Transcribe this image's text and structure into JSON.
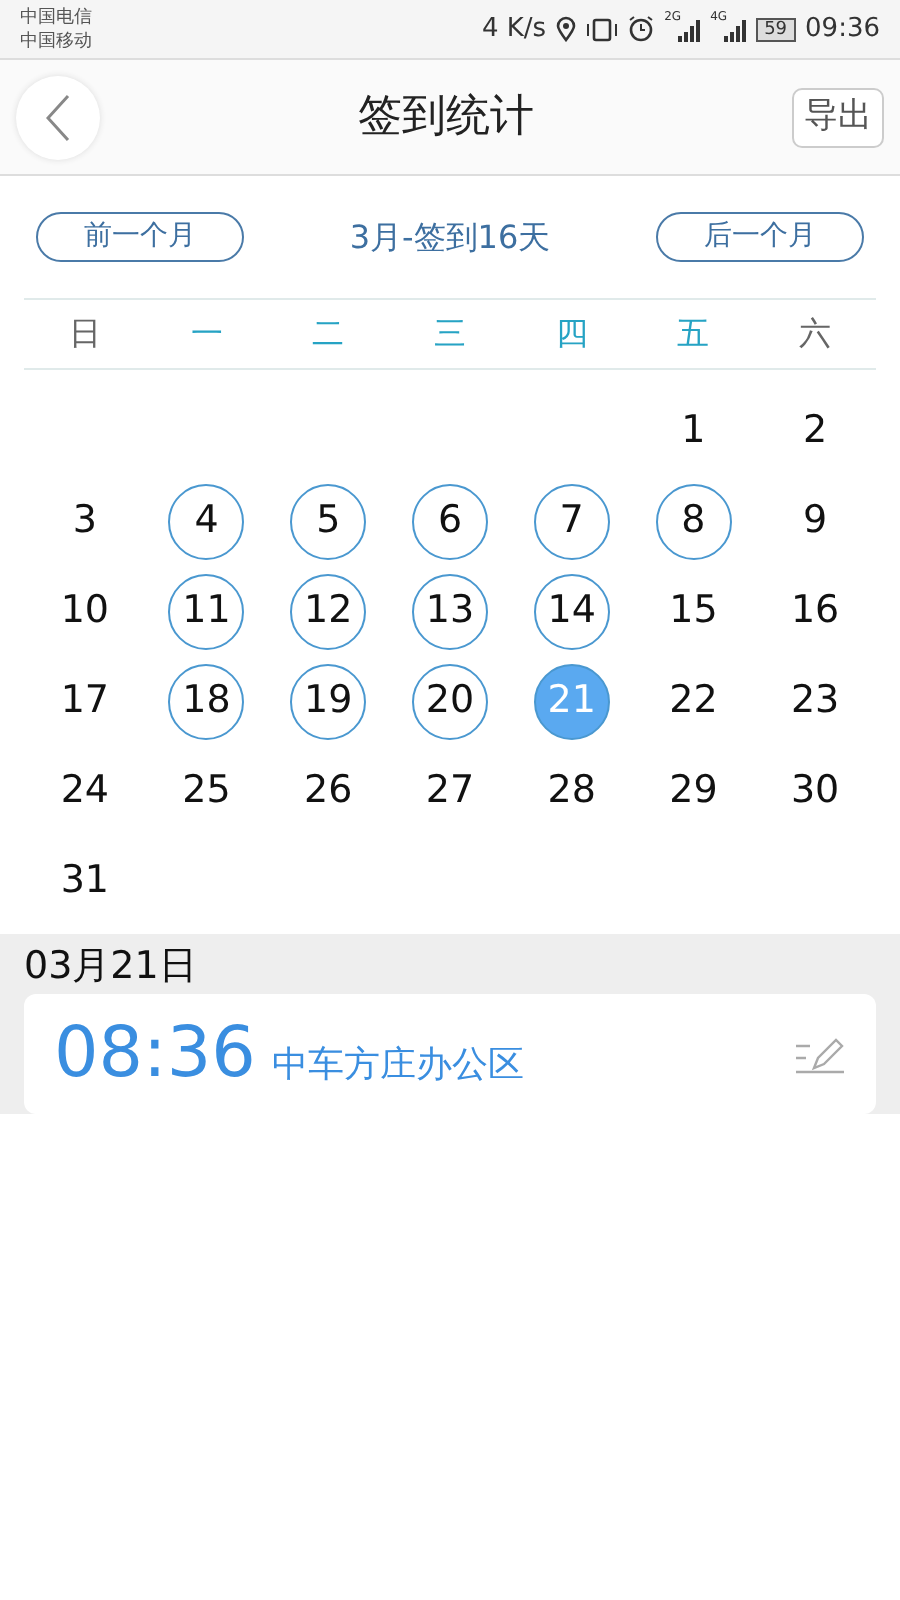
{
  "status_bar": {
    "carriers": [
      "中国电信",
      "中国移动"
    ],
    "speed": "4 K/s",
    "sim_labels": [
      "2G",
      "4G"
    ],
    "battery": "59",
    "time": "09:36"
  },
  "header": {
    "title": "签到统计",
    "action": "导出"
  },
  "month_nav": {
    "prev": "前一个月",
    "summary": "3月-签到16天",
    "next": "后一个月"
  },
  "weekdays": [
    {
      "label": "日",
      "weekend": true
    },
    {
      "label": "一",
      "weekend": false
    },
    {
      "label": "二",
      "weekend": false
    },
    {
      "label": "三",
      "weekend": false
    },
    {
      "label": "四",
      "weekend": false
    },
    {
      "label": "五",
      "weekend": false
    },
    {
      "label": "六",
      "weekend": true
    }
  ],
  "days": [
    {
      "kind": "blank"
    },
    {
      "kind": "blank"
    },
    {
      "kind": "blank"
    },
    {
      "kind": "blank"
    },
    {
      "kind": "blank"
    },
    {
      "kind": "day",
      "label": "1",
      "signed": false,
      "selected": false
    },
    {
      "kind": "day",
      "label": "2",
      "signed": false,
      "selected": false
    },
    {
      "kind": "day",
      "label": "3",
      "signed": false,
      "selected": false
    },
    {
      "kind": "day",
      "label": "4",
      "signed": true,
      "selected": false
    },
    {
      "kind": "day",
      "label": "5",
      "signed": true,
      "selected": false
    },
    {
      "kind": "day",
      "label": "6",
      "signed": true,
      "selected": false
    },
    {
      "kind": "day",
      "label": "7",
      "signed": true,
      "selected": false
    },
    {
      "kind": "day",
      "label": "8",
      "signed": true,
      "selected": false
    },
    {
      "kind": "day",
      "label": "9",
      "signed": false,
      "selected": false
    },
    {
      "kind": "day",
      "label": "10",
      "signed": false,
      "selected": false
    },
    {
      "kind": "day",
      "label": "11",
      "signed": true,
      "selected": false
    },
    {
      "kind": "day",
      "label": "12",
      "signed": true,
      "selected": false
    },
    {
      "kind": "day",
      "label": "13",
      "signed": true,
      "selected": false
    },
    {
      "kind": "day",
      "label": "14",
      "signed": true,
      "selected": false
    },
    {
      "kind": "day",
      "label": "15",
      "signed": false,
      "selected": false
    },
    {
      "kind": "day",
      "label": "16",
      "signed": false,
      "selected": false
    },
    {
      "kind": "day",
      "label": "17",
      "signed": false,
      "selected": false
    },
    {
      "kind": "day",
      "label": "18",
      "signed": true,
      "selected": false
    },
    {
      "kind": "day",
      "label": "19",
      "signed": true,
      "selected": false
    },
    {
      "kind": "day",
      "label": "20",
      "signed": true,
      "selected": false
    },
    {
      "kind": "day",
      "label": "21",
      "signed": true,
      "selected": true
    },
    {
      "kind": "day",
      "label": "22",
      "signed": false,
      "selected": false
    },
    {
      "kind": "day",
      "label": "23",
      "signed": false,
      "selected": false
    },
    {
      "kind": "day",
      "label": "24",
      "signed": false,
      "selected": false
    },
    {
      "kind": "day",
      "label": "25",
      "signed": false,
      "selected": false
    },
    {
      "kind": "day",
      "label": "26",
      "signed": false,
      "selected": false
    },
    {
      "kind": "day",
      "label": "27",
      "signed": false,
      "selected": false
    },
    {
      "kind": "day",
      "label": "28",
      "signed": false,
      "selected": false
    },
    {
      "kind": "day",
      "label": "29",
      "signed": false,
      "selected": false
    },
    {
      "kind": "day",
      "label": "30",
      "signed": false,
      "selected": false
    },
    {
      "kind": "day",
      "label": "31",
      "signed": false,
      "selected": false
    }
  ],
  "record": {
    "date": "03月21日",
    "time": "08:36",
    "place": "中车方庄办公区"
  }
}
